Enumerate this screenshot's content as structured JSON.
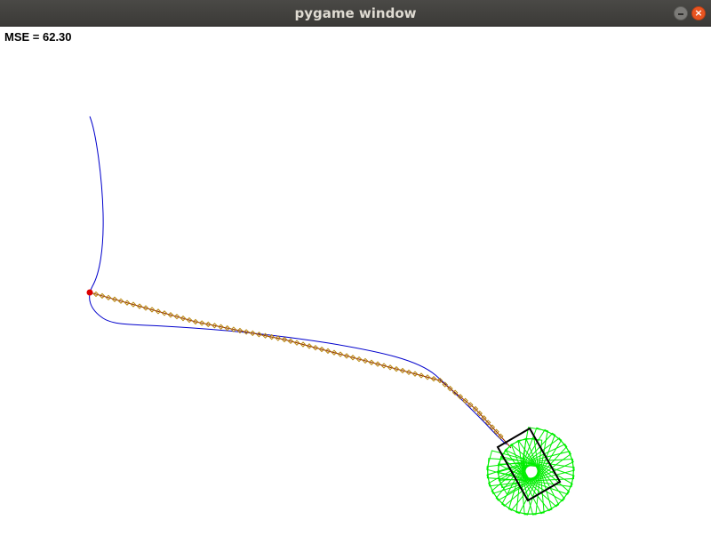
{
  "window": {
    "title": "pygame window",
    "close_glyph": "×"
  },
  "hud": {
    "mse_text": "MSE = 62.30"
  },
  "colors": {
    "path": "#0000cc",
    "trail": "#8b2200",
    "trail_marker": "#b8860b",
    "ghost": "#00ee00",
    "vehicle": "#000000",
    "start_point": "#dd0000"
  },
  "icons": {
    "minimize": "minimize-icon",
    "close": "close-icon"
  }
}
